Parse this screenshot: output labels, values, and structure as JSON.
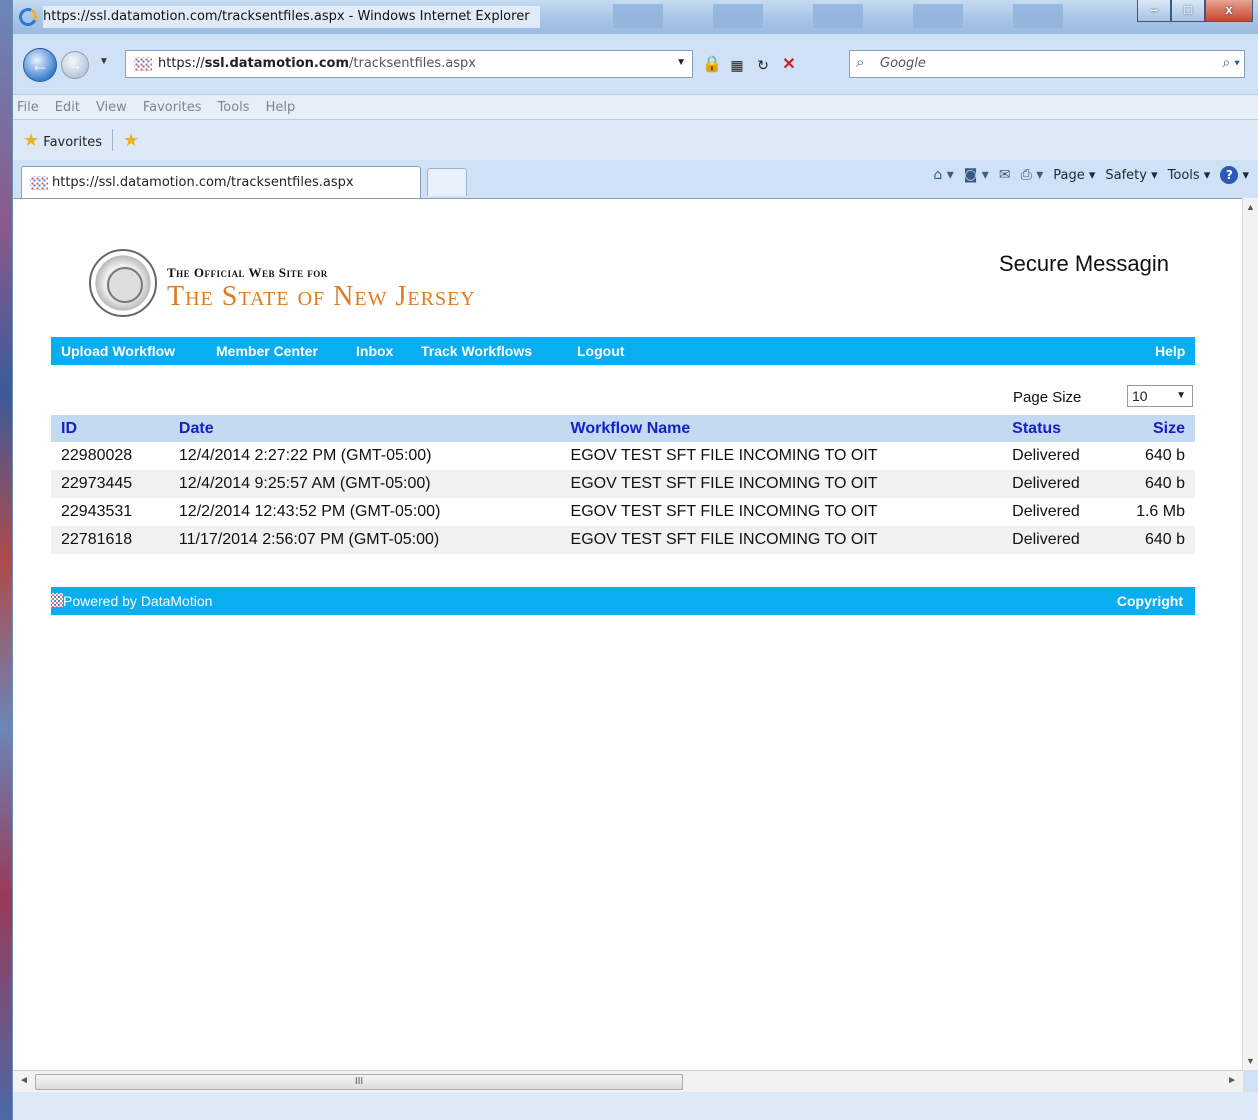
{
  "window": {
    "title": "https://ssl.datamotion.com/tracksentfiles.aspx - Windows Internet Explorer"
  },
  "address_bar": {
    "scheme": "https://",
    "host": "ssl.datamotion.com",
    "path": "/tracksentfiles.aspx"
  },
  "search": {
    "placeholder": "Google"
  },
  "menu": [
    "File",
    "Edit",
    "View",
    "Favorites",
    "Tools",
    "Help"
  ],
  "favorites": {
    "label": "Favorites"
  },
  "tab": {
    "title": "https://ssl.datamotion.com/tracksentfiles.aspx"
  },
  "command_bar": {
    "page": "Page ▾",
    "safety": "Safety ▾",
    "tools": "Tools ▾"
  },
  "site": {
    "subtitle": "The Official Web Site for",
    "title": "The State of New Jersey",
    "app_title": "Secure Messagin"
  },
  "nav": {
    "upload": "Upload Workflow",
    "member": "Member Center",
    "inbox": "Inbox",
    "track": "Track Workflows",
    "logout": "Logout",
    "help": "Help"
  },
  "page_size": {
    "label": "Page Size",
    "value": "10"
  },
  "table": {
    "headers": {
      "id": "ID",
      "date": "Date",
      "workflow": "Workflow Name",
      "status": "Status",
      "size": "Size"
    },
    "rows": [
      {
        "id": "22980028",
        "date": "12/4/2014 2:27:22 PM (GMT-05:00)",
        "workflow": "EGOV TEST SFT FILE INCOMING TO OIT",
        "status": "Delivered",
        "size": "640 b"
      },
      {
        "id": "22973445",
        "date": "12/4/2014 9:25:57 AM (GMT-05:00)",
        "workflow": "EGOV TEST SFT FILE INCOMING TO OIT",
        "status": "Delivered",
        "size": "640 b"
      },
      {
        "id": "22943531",
        "date": "12/2/2014 12:43:52 PM (GMT-05:00)",
        "workflow": "EGOV TEST SFT FILE INCOMING TO OIT",
        "status": "Delivered",
        "size": "1.6 Mb"
      },
      {
        "id": "22781618",
        "date": "11/17/2014 2:56:07 PM (GMT-05:00)",
        "workflow": "EGOV TEST SFT FILE INCOMING TO OIT",
        "status": "Delivered",
        "size": "640 b"
      }
    ]
  },
  "footer": {
    "powered": "Powered by DataMotion",
    "copyright": "Copyright"
  },
  "scroll": {
    "hthumb_grip": "III"
  },
  "colors": {
    "accent": "#08aef0",
    "header_bg": "#c4daf0",
    "header_text": "#1620c8",
    "brand_orange": "#e07b1f"
  }
}
